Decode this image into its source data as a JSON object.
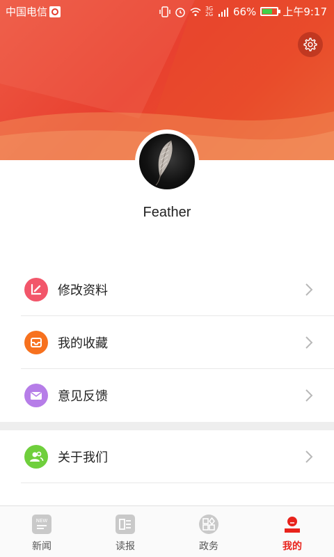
{
  "status_bar": {
    "carrier": "中国电信",
    "network": "3G 2G",
    "battery_percent": "66%",
    "time": "上午9:17"
  },
  "profile": {
    "username": "Feather"
  },
  "menu": [
    {
      "label": "修改资料",
      "icon": "edit-icon",
      "color": "#f2566a"
    },
    {
      "label": "我的收藏",
      "icon": "inbox-icon",
      "color": "#f7711e"
    },
    {
      "label": "意见反馈",
      "icon": "mail-icon",
      "color": "#b67de8"
    },
    {
      "label": "关于我们",
      "icon": "users-icon",
      "color": "#6fcf3c"
    }
  ],
  "tabs": [
    {
      "label": "新闻",
      "icon": "news-icon",
      "badge_text": "NEW"
    },
    {
      "label": "读报",
      "icon": "newspaper-icon"
    },
    {
      "label": "政务",
      "icon": "shapes-icon"
    },
    {
      "label": "我的",
      "icon": "profile-icon",
      "active": true
    }
  ],
  "colors": {
    "header_primary": "#e8402f",
    "accent": "#e8231c"
  }
}
